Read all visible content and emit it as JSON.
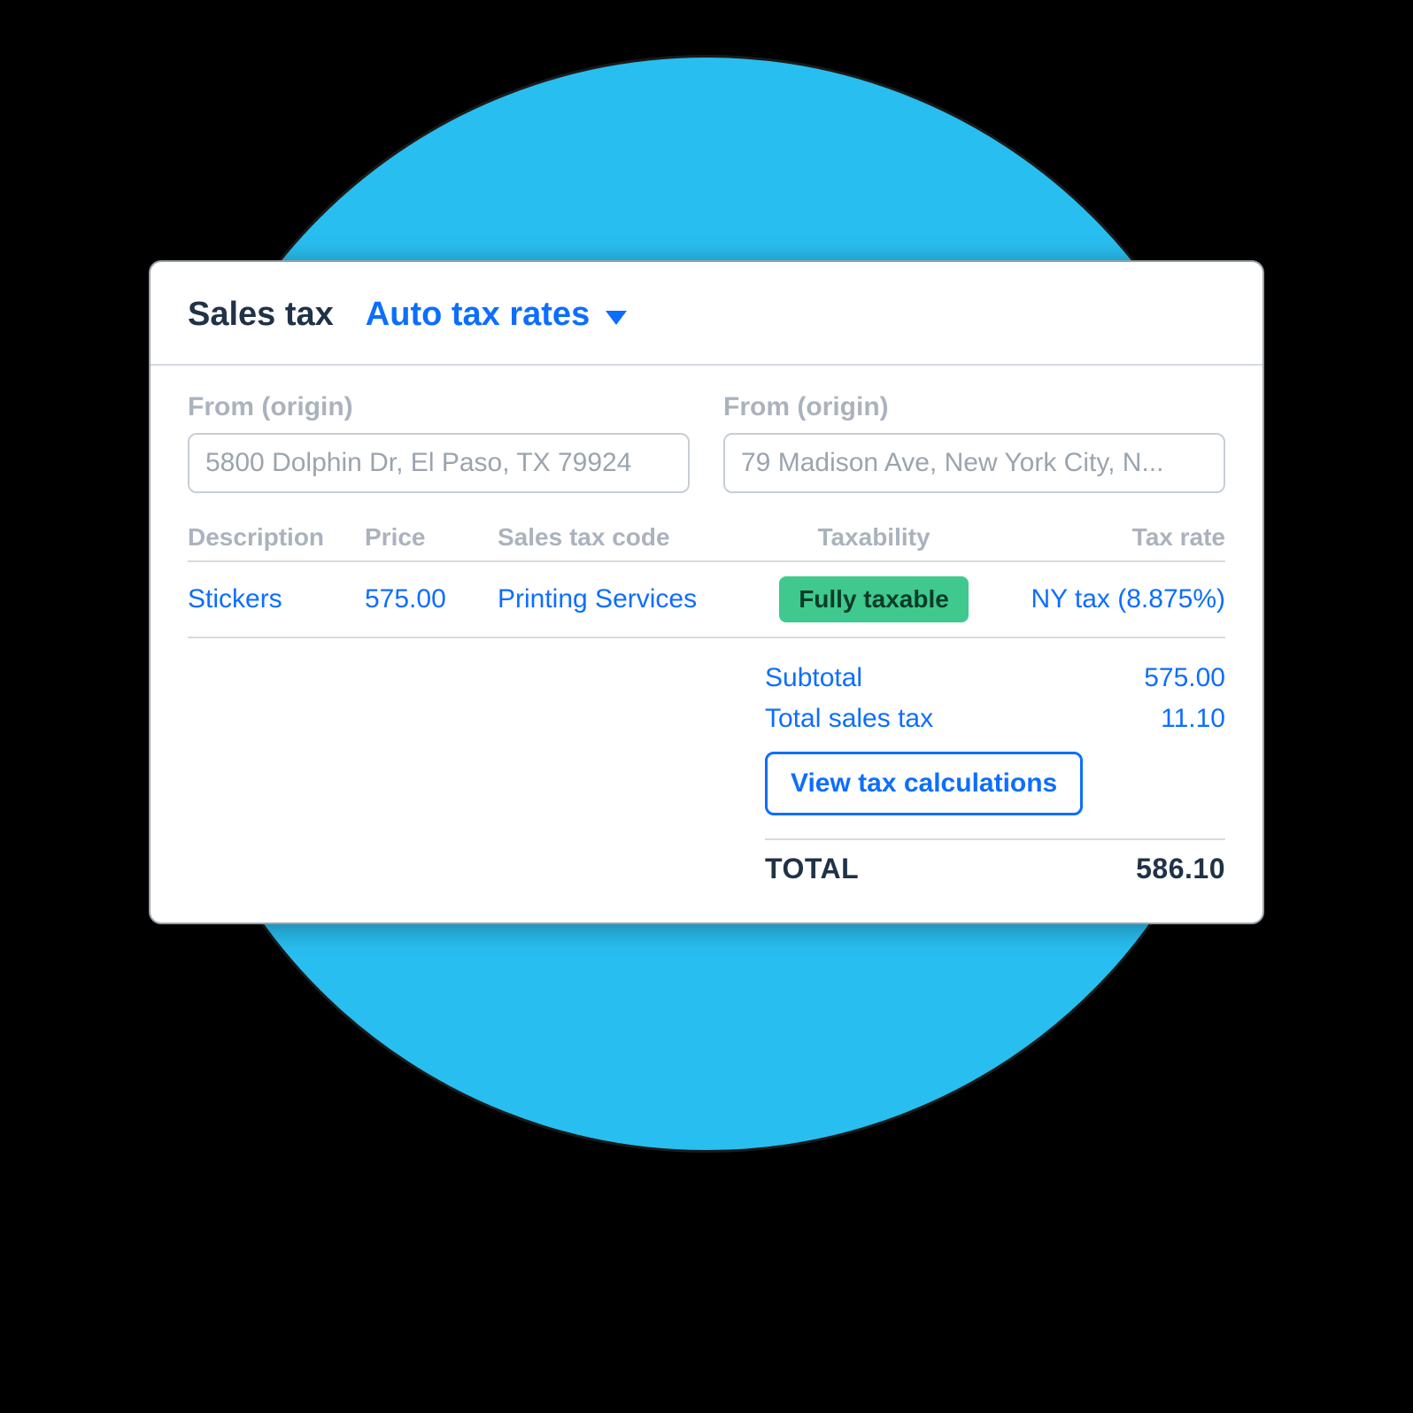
{
  "header": {
    "title": "Sales tax",
    "dropdown_label": "Auto tax rates"
  },
  "addresses": {
    "left_label": "From (origin)",
    "left_value": "5800 Dolphin Dr, El Paso, TX 79924",
    "right_label": "From (origin)",
    "right_value": "79 Madison Ave, New York City, N..."
  },
  "columns": {
    "description": "Description",
    "price": "Price",
    "code": "Sales tax code",
    "taxability": "Taxability",
    "rate": "Tax rate"
  },
  "row": {
    "description": "Stickers",
    "price": "575.00",
    "code": "Printing Services",
    "taxability": "Fully taxable",
    "rate": "NY tax (8.875%)"
  },
  "totals": {
    "subtotal_label": "Subtotal",
    "subtotal_value": "575.00",
    "tax_label": "Total sales tax",
    "tax_value": "11.10",
    "view_button": "View tax calculations",
    "grand_label": "TOTAL",
    "grand_value": "586.10"
  }
}
